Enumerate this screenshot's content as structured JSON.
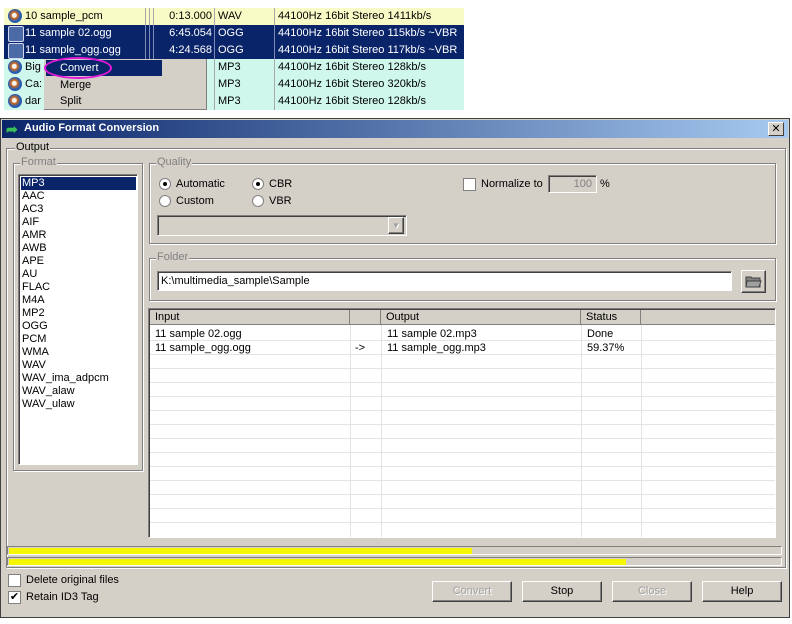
{
  "file_list": [
    {
      "name": "10 sample_pcm",
      "time": "0:13.000",
      "type": "WAV",
      "info": "44100Hz 16bit Stereo 1411kb/s",
      "state": "normal"
    },
    {
      "name": "11 sample 02.ogg",
      "time": "6:45.054",
      "type": "OGG",
      "info": "44100Hz 16bit Stereo 115kb/s ~VBR",
      "state": "selected"
    },
    {
      "name": "11 sample_ogg.ogg",
      "time": "4:24.568",
      "type": "OGG",
      "info": "44100Hz 16bit Stereo 117kb/s ~VBR",
      "state": "selected"
    },
    {
      "name": "Big",
      "time": "",
      "type": "MP3",
      "info": "44100Hz 16bit Stereo 128kb/s",
      "state": "covered"
    },
    {
      "name": "Ca:",
      "time": "",
      "type": "MP3",
      "info": "44100Hz 16bit Stereo 320kb/s",
      "state": "covered"
    },
    {
      "name": "dar",
      "time": "",
      "type": "MP3",
      "info": "44100Hz 16bit Stereo 128kb/s",
      "state": "covered"
    }
  ],
  "context_menu": {
    "items": [
      "Convert",
      "Merge",
      "Split"
    ],
    "highlighted": "Convert"
  },
  "dialog": {
    "title": "Audio Format Conversion",
    "close_glyph": "✕",
    "output_group": "Output",
    "format_group": "Format",
    "formats": [
      "MP3",
      "AAC",
      "AC3",
      "AIF",
      "AMR",
      "AWB",
      "APE",
      "AU",
      "FLAC",
      "M4A",
      "MP2",
      "OGG",
      "PCM",
      "WMA",
      "WAV",
      "WAV_ima_adpcm",
      "WAV_alaw",
      "WAV_ulaw"
    ],
    "selected_format": "MP3",
    "quality_group": "Quality",
    "quality_modes": {
      "automatic": "Automatic",
      "custom": "Custom"
    },
    "quality_mode_selected": "Automatic",
    "bitrate_modes": {
      "cbr": "CBR",
      "vbr": "VBR"
    },
    "bitrate_mode_selected": "CBR",
    "normalize": {
      "label": "Normalize to",
      "value": "100",
      "unit": "%",
      "checked": false
    },
    "preset_dropdown": {
      "value": "",
      "arrow": "▼"
    },
    "folder_group": "Folder",
    "folder_path": "K:\\multimedia_sample\\Sample",
    "table": {
      "headers": [
        "Input",
        "",
        "Output",
        "Status",
        ""
      ],
      "rows": [
        {
          "input": "11 sample 02.ogg",
          "arrow": "",
          "output": "11 sample 02.mp3",
          "status": "Done"
        },
        {
          "input": "11 sample_ogg.ogg",
          "arrow": "->",
          "output": "11 sample_ogg.mp3",
          "status": "59.37%"
        }
      ]
    },
    "progress": {
      "overall": 0.6,
      "current": 0.8
    },
    "delete_original": {
      "label": "Delete original files",
      "checked": false
    },
    "retain_id3": {
      "label": "Retain ID3 Tag",
      "checked": true
    },
    "buttons": {
      "convert": "Convert",
      "stop": "Stop",
      "close": "Close",
      "help": "Help"
    }
  },
  "colors": {
    "highlight_ring": "#e11ad8",
    "selection": "#0a246a",
    "progress": "#f6f600"
  }
}
